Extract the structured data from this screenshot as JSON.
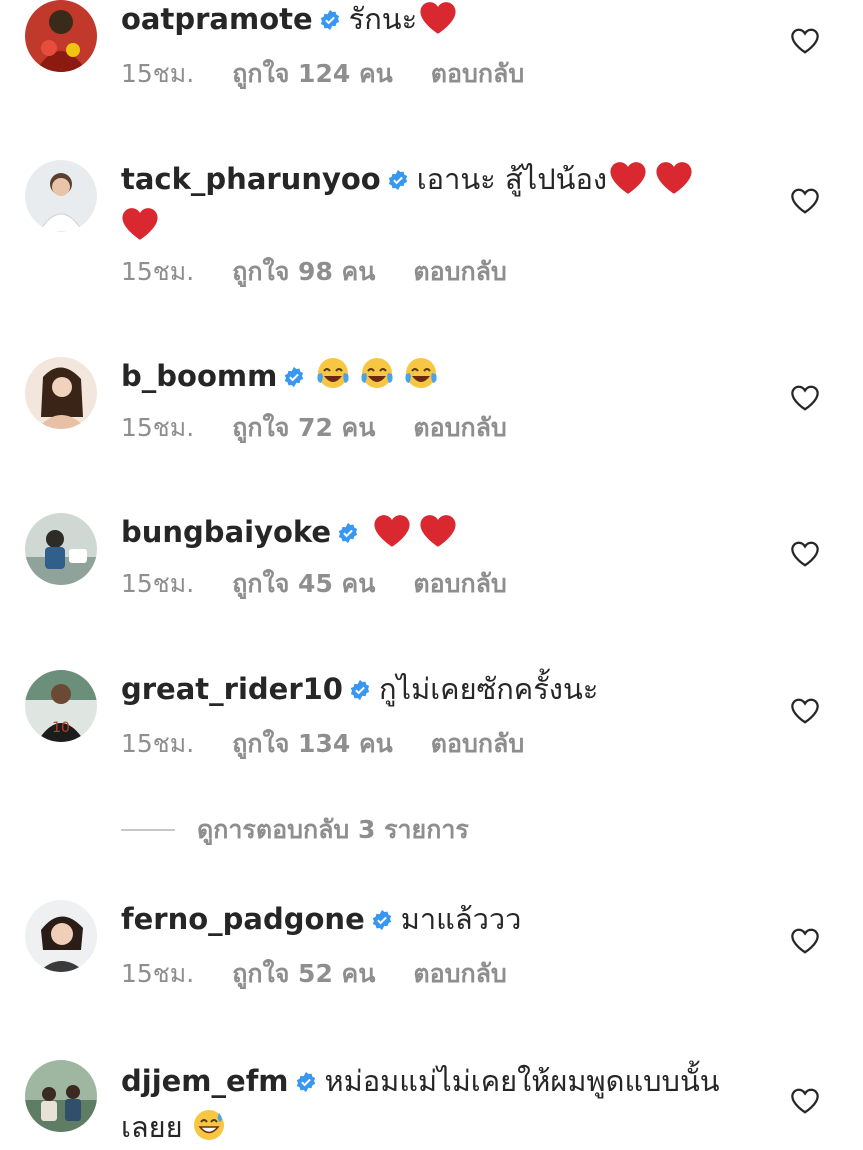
{
  "comments": [
    {
      "username": "oatpramote",
      "text": "รักนะ",
      "emojis": [
        "red-heart"
      ],
      "time": "15ชม.",
      "likes": "ถูกใจ 124 คน",
      "reply": "ตอบกลับ"
    },
    {
      "username": "tack_pharunyoo",
      "text": "เอานะ สู้ไปน้อง",
      "emojis": [
        "red-heart",
        "red-heart",
        "red-heart"
      ],
      "time": "15ชม.",
      "likes": "ถูกใจ 98 คน",
      "reply": "ตอบกลับ"
    },
    {
      "username": "b_boomm",
      "text": "",
      "emojis": [
        "tears-of-joy",
        "tears-of-joy",
        "tears-of-joy"
      ],
      "time": "15ชม.",
      "likes": "ถูกใจ 72 คน",
      "reply": "ตอบกลับ"
    },
    {
      "username": "bungbaiyoke",
      "text": "",
      "emojis": [
        "red-heart",
        "red-heart"
      ],
      "time": "15ชม.",
      "likes": "ถูกใจ 45 คน",
      "reply": "ตอบกลับ"
    },
    {
      "username": "great_rider10",
      "text": "กูไม่เคยซักครั้งนะ",
      "emojis": [],
      "time": "15ชม.",
      "likes": "ถูกใจ 134 คน",
      "reply": "ตอบกลับ"
    },
    {
      "username": "ferno_padgone",
      "text": "มาแล้ววว",
      "emojis": [],
      "time": "15ชม.",
      "likes": "ถูกใจ 52 คน",
      "reply": "ตอบกลับ"
    },
    {
      "username": "djjem_efm",
      "text": "หม่อมแม่ไม่เคยให้ผมพูดแบบนั้นเลยย",
      "emojis": [
        "grinning-sweat"
      ],
      "time": "",
      "likes": "",
      "reply": ""
    }
  ],
  "view_replies": "ดูการตอบกลับ 3 รายการ",
  "colors": {
    "text": "#262626",
    "muted": "#8e8e8e",
    "verified": "#3897f0",
    "heart_outline": "#262626"
  },
  "icons": {
    "verified": "verified-badge-icon",
    "like": "heart-outline-icon"
  }
}
